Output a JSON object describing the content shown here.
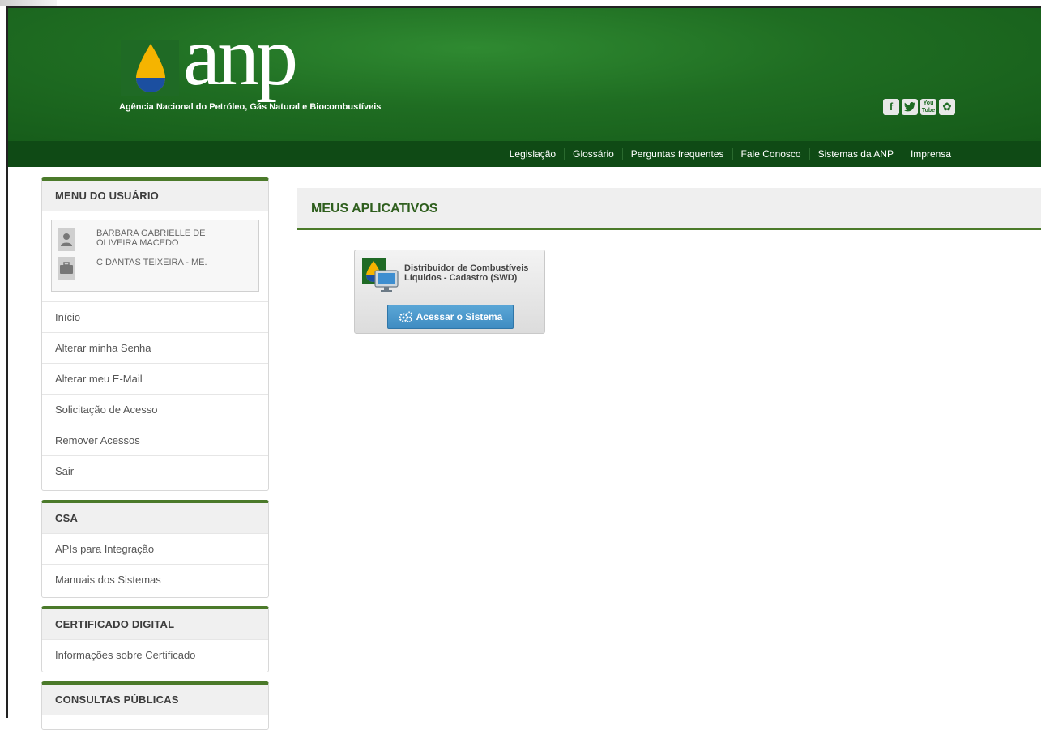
{
  "header": {
    "logo_text": "anp",
    "subtitle": "Agência Nacional do Petróleo, Gás Natural e Biocombustíveis",
    "social": [
      {
        "name": "facebook-icon",
        "glyph": "f"
      },
      {
        "name": "twitter-icon",
        "glyph": "🐦"
      },
      {
        "name": "youtube-icon",
        "glyph": "You Tube"
      },
      {
        "name": "flickr-icon",
        "glyph": "✿"
      }
    ]
  },
  "nav": {
    "items": [
      "Legislação",
      "Glossário",
      "Perguntas frequentes",
      "Fale Conosco",
      "Sistemas da ANP",
      "Imprensa"
    ]
  },
  "user_menu": {
    "title": "MENU DO USUÁRIO",
    "user_name": "BARBARA GABRIELLE DE OLIVEIRA MACEDO",
    "company": "C DANTAS TEIXEIRA - ME.",
    "items": [
      "Início",
      "Alterar minha Senha",
      "Alterar meu E-Mail",
      "Solicitação de Acesso",
      "Remover Acessos",
      "Sair"
    ]
  },
  "csa": {
    "title": "CSA",
    "items": [
      "APIs para Integração",
      "Manuais dos Sistemas"
    ]
  },
  "certificado": {
    "title": "CERTIFICADO DIGITAL",
    "items": [
      "Informações sobre Certificado"
    ]
  },
  "consultas": {
    "title": "CONSULTAS PÚBLICAS"
  },
  "main": {
    "title": "MEUS APLICATIVOS",
    "apps": [
      {
        "name": "Distribuidor de Combustíveis Líquidos - Cadastro (SWD)",
        "button": "Acessar o Sistema"
      }
    ]
  },
  "colors": {
    "header_green": "#1f6d22",
    "nav_green": "#0f4a15",
    "accent_green": "#4b7a2a",
    "button_blue": "#3f8cc2"
  }
}
